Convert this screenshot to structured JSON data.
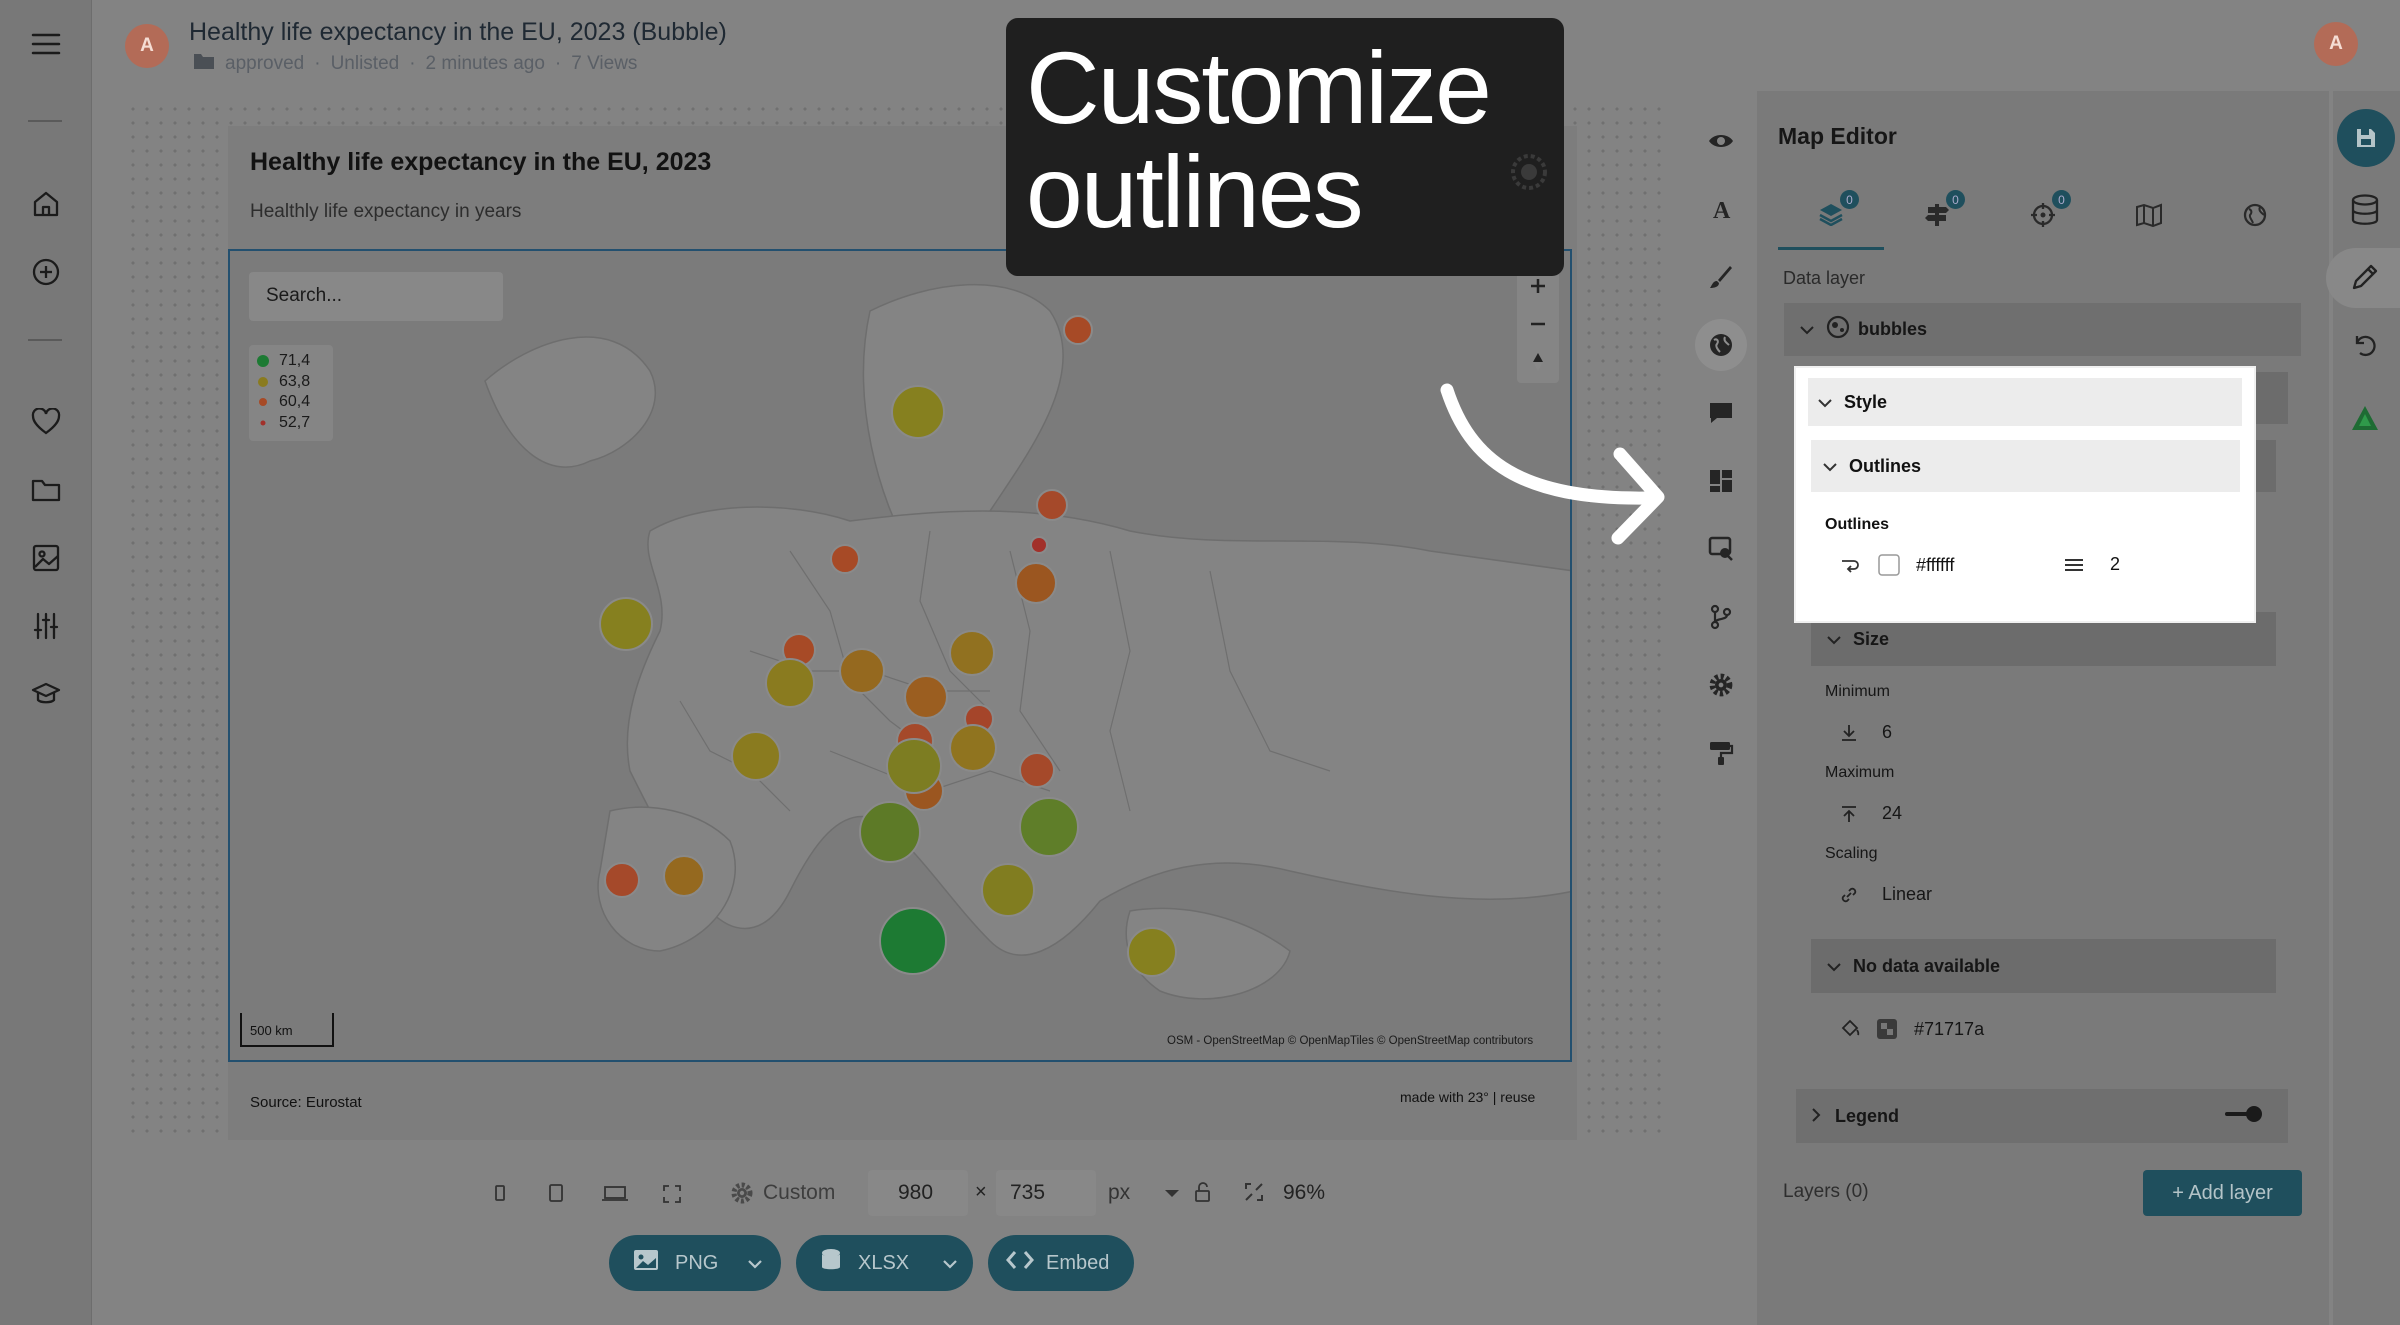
{
  "app": {
    "title": "Healthy life expectancy in the EU, 2023 (Bubble)",
    "meta": {
      "status": "approved",
      "visibility": "Unlisted",
      "edited": "2 minutes ago",
      "views": "7 Views"
    },
    "avatar_letter": "A"
  },
  "sidebar": {
    "items": [
      "menu-icon",
      "home-icon",
      "add-icon",
      "heart-icon",
      "folder-icon",
      "image-icon",
      "sliders-icon",
      "academy-icon"
    ]
  },
  "chart": {
    "title": "Healthy life expectancy in the EU, 2023",
    "subtitle": "Healthly life expectancy in years",
    "search_placeholder": "Search...",
    "legend": [
      {
        "label": "71,4",
        "color": "#17a02e"
      },
      {
        "label": "63,8",
        "color": "#c9a412"
      },
      {
        "label": "60,4",
        "color": "#d15c16"
      },
      {
        "label": "52,7",
        "color": "#d0221b"
      }
    ],
    "scale_label": "500 km",
    "attribution": "OSM - OpenStreetMap  © OpenMapTiles © OpenStreetMap contributors",
    "source": "Source: Eurostat",
    "made_with": "made with 23° | reuse"
  },
  "toolbar": {
    "preset": "Custom",
    "width": "980",
    "times": "×",
    "height": "735",
    "unit": "px",
    "zoom": "96%",
    "png_label": "PNG",
    "xlsx_label": "XLSX",
    "embed_label": "Embed"
  },
  "editor": {
    "title": "Map Editor",
    "tab_badges": [
      "0",
      "0",
      "0"
    ],
    "data_layer_label": "Data layer",
    "layer_name": "bubbles",
    "style_label": "Style",
    "outlines_section": "Outlines",
    "outlines_label": "Outlines",
    "outline_color": "#ffffff",
    "outline_width": "2",
    "size_label": "Size",
    "minimum_label": "Minimum",
    "minimum_value": "6",
    "maximum_label": "Maximum",
    "maximum_value": "24",
    "scaling_label": "Scaling",
    "scaling_value": "Linear",
    "no_data_label": "No data available",
    "no_data_color": "#71717a",
    "legend_label": "Legend",
    "layers_label": "Layers (0)",
    "add_layer_label": "+ Add layer"
  },
  "banner": {
    "line1": "Customize",
    "line2": "outlines"
  },
  "colors": {
    "accent": "#1f4f5d",
    "overlay": "#838383"
  }
}
